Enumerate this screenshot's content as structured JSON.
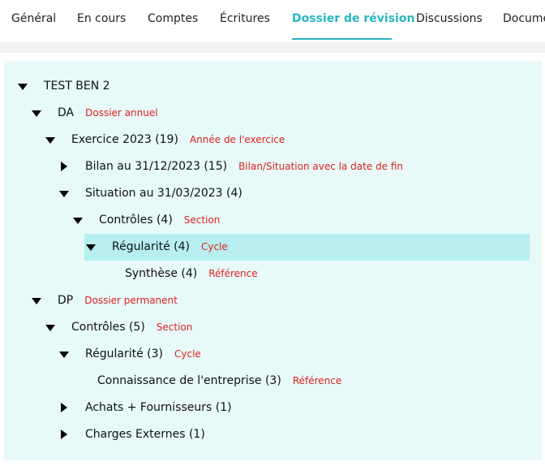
{
  "tabs": [
    {
      "label": "Général"
    },
    {
      "label": "En cours"
    },
    {
      "label": "Comptes"
    },
    {
      "label": "Écritures"
    },
    {
      "label": "Dossier de révision",
      "active": true
    },
    {
      "label": "Discussions"
    },
    {
      "label": "Docume"
    }
  ],
  "colors": {
    "accent": "#27b7c2",
    "panel_bg": "#e7f9f9",
    "selected_bg": "#b7eef0",
    "annotation": "#e0211c"
  },
  "tree": {
    "root": {
      "label": "TEST BEN 2",
      "expanded": true
    },
    "da": {
      "label": "DA",
      "note": "Dossier annuel",
      "expanded": true
    },
    "exercice": {
      "label": "Exercice 2023 (19)",
      "note": "Année de l'exercice",
      "expanded": true
    },
    "bilan": {
      "label": "Bilan au 31/12/2023 (15)",
      "note": "Bilan/Situation avec la date de fin",
      "expanded": false
    },
    "situation": {
      "label": "Situation au 31/03/2023 (4)",
      "expanded": true
    },
    "controles_da": {
      "label": "Contrôles (4)",
      "note": "Section",
      "expanded": true
    },
    "regularite_da": {
      "label": "Régularité (4)",
      "note": "Cycle",
      "expanded": true,
      "selected": true
    },
    "synthese": {
      "label": "Synthèse (4)",
      "note": "Référence"
    },
    "dp": {
      "label": "DP",
      "note": "Dossier permanent",
      "expanded": true
    },
    "controles_dp": {
      "label": "Contrôles (5)",
      "note": "Section",
      "expanded": true
    },
    "regularite_dp": {
      "label": "Régularité (3)",
      "note": "Cycle",
      "expanded": true
    },
    "connaissance": {
      "label": "Connaissance de l'entreprise (3)",
      "note": "Référence"
    },
    "achats": {
      "label": "Achats + Fournisseurs (1)",
      "expanded": false
    },
    "charges": {
      "label": "Charges Externes (1)",
      "expanded": false
    }
  }
}
